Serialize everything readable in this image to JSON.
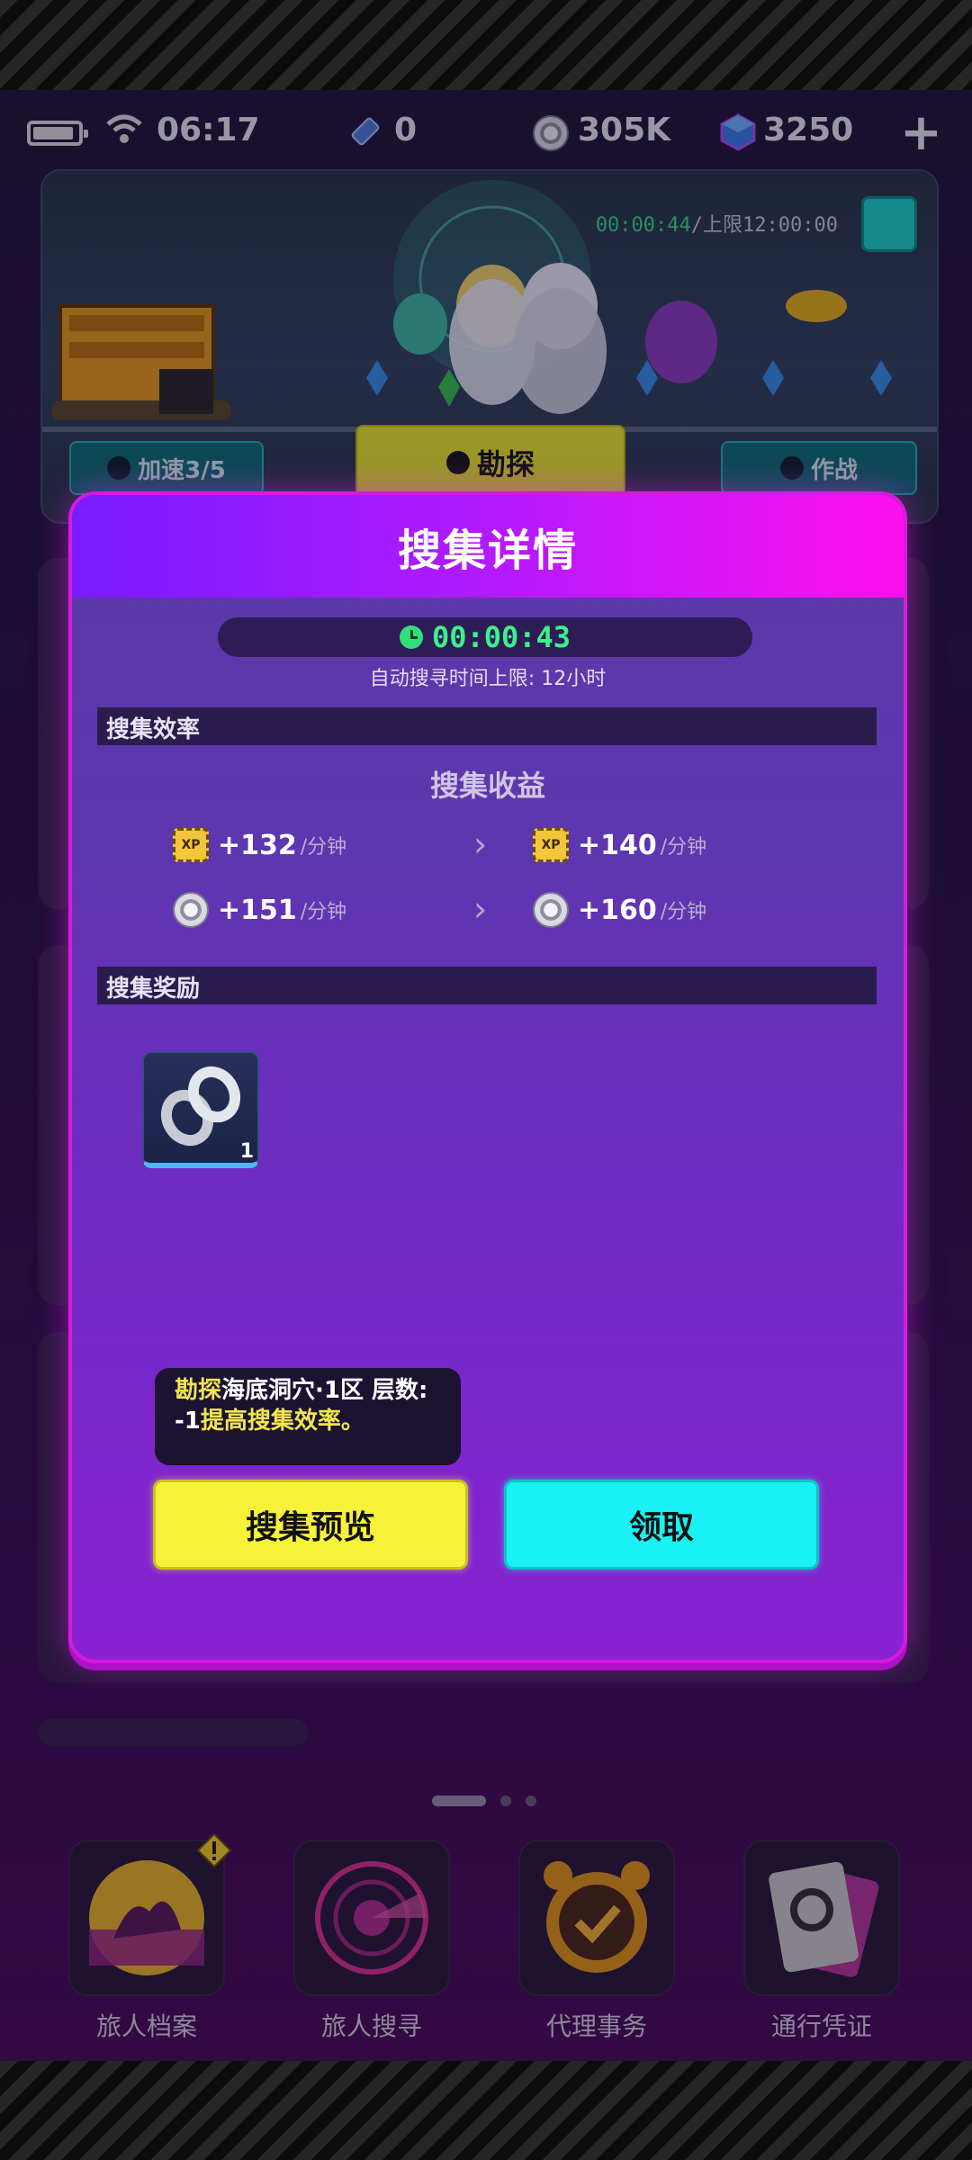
{
  "status_bar": {
    "time": "06:17",
    "tickets": "0",
    "coins": "305K",
    "gems": "3250",
    "add_symbol": "+"
  },
  "scene": {
    "timer": "00:00:44",
    "timer_limit": "/上限12:00:00",
    "speedup_label": "加速3/5",
    "explore_label": "勘探",
    "battle_label": "作战"
  },
  "modal": {
    "title": "搜集详情",
    "timer": "00:00:43",
    "auto_limit": "自动搜寻时间上限: 12小时",
    "efficiency_header": "搜集效率",
    "income_title": "搜集收益",
    "rates": [
      {
        "icon": "xp-icon",
        "current": "+132",
        "next": "+140",
        "unit": "/分钟"
      },
      {
        "icon": "coin-icon",
        "current": "+151",
        "next": "+160",
        "unit": "/分钟"
      }
    ],
    "rewards_header": "搜集奖励",
    "reward_count": "1",
    "tip_prefix": "勘探",
    "tip_middle": "海底洞穴·1区 层数: -1",
    "tip_highlight": "提高搜集效率。",
    "preview_button": "搜集预览",
    "claim_button": "领取"
  },
  "bottom_nav": [
    {
      "label": "旅人档案",
      "icon": "traveler-archive-icon"
    },
    {
      "label": "旅人搜寻",
      "icon": "radar-icon"
    },
    {
      "label": "代理事务",
      "icon": "alarm-clock-icon"
    },
    {
      "label": "通行凭证",
      "icon": "pass-card-icon"
    }
  ],
  "colors": {
    "modal_header_start": "#7a1bff",
    "modal_header_end": "#ff10ee",
    "preview_button": "#f6f23a",
    "claim_button": "#19f1f4",
    "timer_green": "#3cf08b"
  }
}
